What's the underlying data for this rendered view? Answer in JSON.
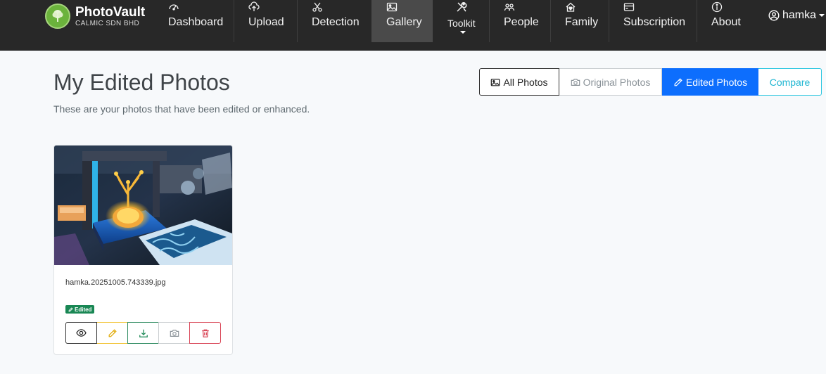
{
  "brand": {
    "name": "PhotoVault",
    "subtitle": "CALMIC SDN BHD"
  },
  "nav": {
    "dashboard": "Dashboard",
    "upload": "Upload",
    "detection": "Detection",
    "gallery": "Gallery",
    "toolkit": "Toolkit",
    "people": "People",
    "family": "Family",
    "subscription": "Subscription",
    "about": "About",
    "active": "Gallery"
  },
  "user": {
    "name": "hamka"
  },
  "page": {
    "title": "My Edited Photos",
    "description": "These are your photos that have been edited or enhanced."
  },
  "filters": {
    "all": "All Photos",
    "original": "Original Photos",
    "edited": "Edited Photos",
    "compare": "Compare",
    "selected": "Edited Photos"
  },
  "photos": [
    {
      "filename": "hamka.20251005.743339.jpg",
      "badge": "Edited"
    }
  ],
  "colors": {
    "navbar": "#282828",
    "primary": "#0d6efd",
    "info": "#2dc7e0",
    "success": "#198754",
    "warning": "#f2c230",
    "danger": "#d94455"
  }
}
